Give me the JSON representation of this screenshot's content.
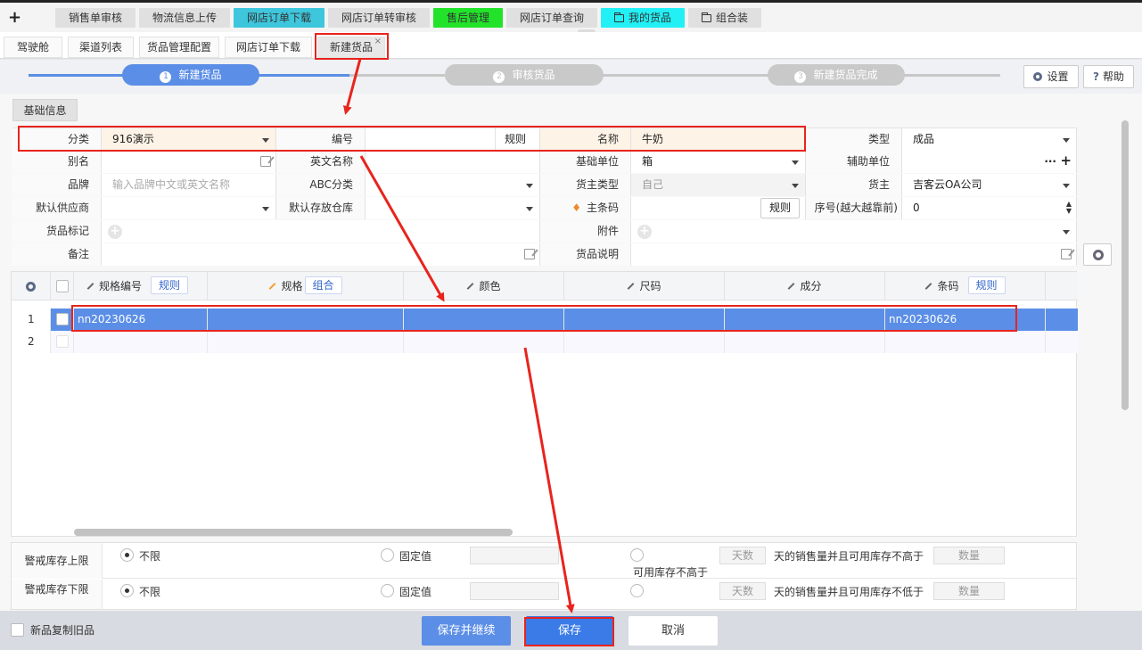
{
  "top_tabs": [
    {
      "label": "销售单审核",
      "bg": "#e0e0e0"
    },
    {
      "label": "物流信息上传",
      "bg": "#e0e0e0"
    },
    {
      "label": "网店订单下载",
      "bg": "#3ec6dc"
    },
    {
      "label": "网店订单转审核",
      "bg": "#e0e0e0"
    },
    {
      "label": "售后管理",
      "bg": "#22e32a"
    },
    {
      "label": "网店订单查询",
      "bg": "#e0e0e0"
    },
    {
      "label": "我的货品",
      "bg": "#22f0f5"
    },
    {
      "label": "组合装",
      "bg": "#e0e0e0"
    }
  ],
  "sub_tabs": [
    "驾驶舱",
    "渠道列表",
    "货品管理配置",
    "网店订单下载",
    "新建货品"
  ],
  "steps": [
    "新建货品",
    "审核货品",
    "新建货品完成"
  ],
  "step_nums": [
    "1",
    "2",
    "3"
  ],
  "toolbar": {
    "settings": "设置",
    "help": "帮助"
  },
  "section_tab": "基础信息",
  "form": {
    "category_label": "分类",
    "category_value": "916演示",
    "code_label": "编号",
    "code_rule": "规则",
    "name_label": "名称",
    "name_value": "牛奶",
    "type_label": "类型",
    "type_value": "成品",
    "alias_label": "别名",
    "en_name_label": "英文名称",
    "base_unit_label": "基础单位",
    "base_unit_value": "箱",
    "aux_unit_label": "辅助单位",
    "aux_unit_value": "···",
    "brand_label": "品牌",
    "brand_placeholder": "输入品牌中文或英文名称",
    "abc_label": "ABC分类",
    "owner_type_label": "货主类型",
    "owner_type_value": "自己",
    "owner_label": "货主",
    "owner_value": "吉客云OA公司",
    "supplier_label": "默认供应商",
    "warehouse_label": "默认存放仓库",
    "barcode_label": "主条码",
    "barcode_rule": "规则",
    "seq_label": "序号(越大越靠前)",
    "seq_value": "0",
    "tag_label": "货品标记",
    "attach_label": "附件",
    "remark_label": "备注",
    "desc_label": "货品说明"
  },
  "grid": {
    "headers": {
      "spec_code": "规格编号",
      "spec_rule": "规则",
      "spec": "规格",
      "spec_combo": "组合",
      "color": "颜色",
      "size": "尺码",
      "material": "成分",
      "barcode": "条码",
      "barcode_rule": "规则"
    },
    "rows": [
      {
        "num": "1",
        "spec_code": "nn20230626",
        "barcode": "nn20230626"
      },
      {
        "num": "2",
        "spec_code": "",
        "barcode": ""
      }
    ]
  },
  "alerts": {
    "upper_label": "警戒库存上限",
    "lower_label": "警戒库存下限",
    "unlimited": "不限",
    "fixed": "固定值",
    "days": "天数",
    "upper_text": "天的销售量并且可用库存不高于",
    "lower_text": "天的销售量并且可用库存不低于",
    "qty": "数量",
    "avail_not_higher": "可用库存不高于"
  },
  "footer": {
    "copy_label": "新品复制旧品",
    "save_continue": "保存并继续",
    "save": "保存",
    "cancel": "取消"
  }
}
